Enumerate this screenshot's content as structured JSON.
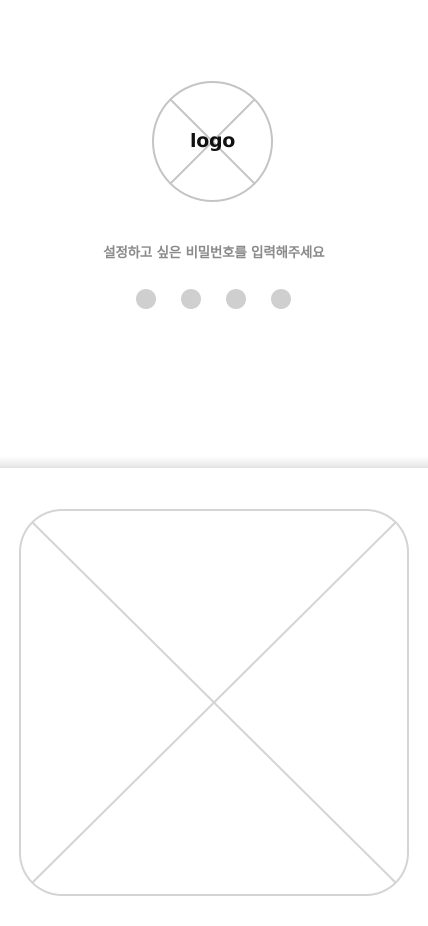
{
  "logo": {
    "text": "logo"
  },
  "pin": {
    "prompt": "설정하고 싶은 비밀번호를 입력해주세요",
    "length": 4,
    "filled": 0,
    "dot_color": "#cfcfcf"
  },
  "colors": {
    "background": "#ffffff",
    "prompt_text": "#8a8a8a",
    "placeholder_stroke": "#d4d4d4",
    "logo_stroke": "#c4c4c4"
  },
  "keypad": {
    "placeholder_icon": "image-placeholder-icon"
  }
}
